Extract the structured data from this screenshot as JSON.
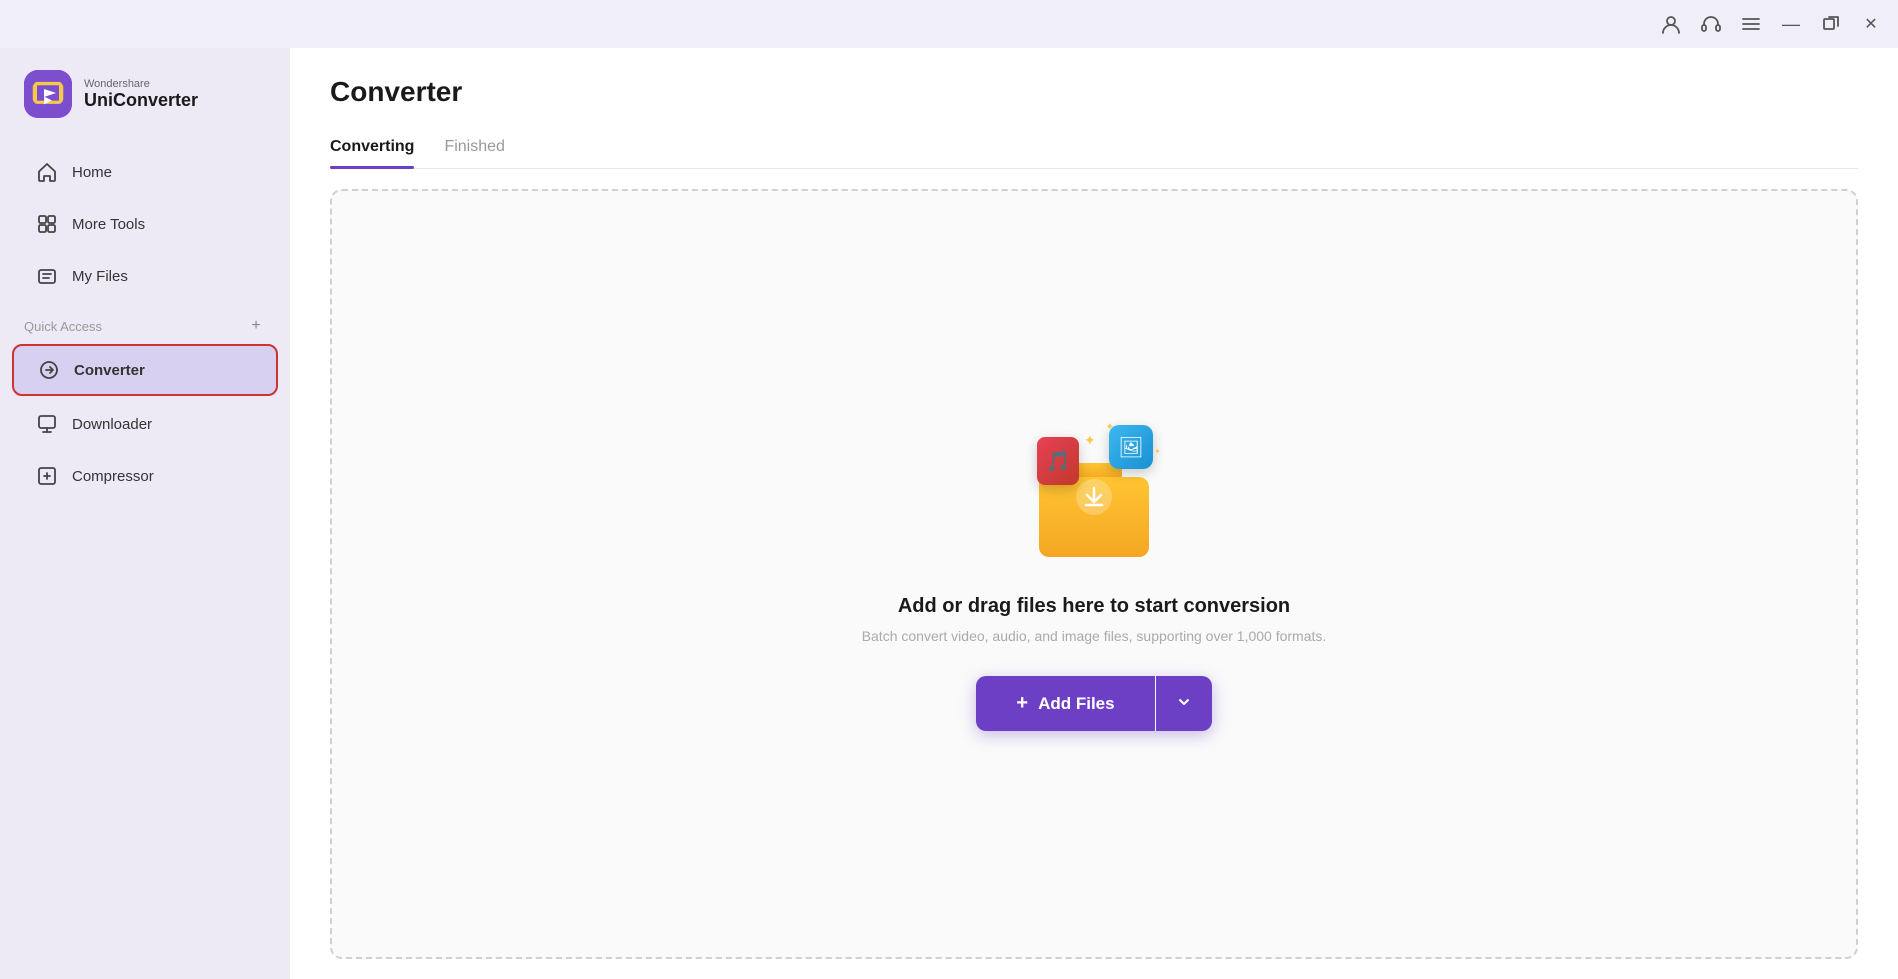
{
  "titlebar": {
    "buttons": [
      {
        "name": "user-icon",
        "symbol": "👤"
      },
      {
        "name": "headset-icon",
        "symbol": "🎧"
      },
      {
        "name": "menu-icon",
        "symbol": "☰"
      },
      {
        "name": "minimize-button",
        "symbol": "—"
      },
      {
        "name": "maximize-button",
        "symbol": "⧉"
      },
      {
        "name": "close-button",
        "symbol": "✕"
      }
    ]
  },
  "sidebar": {
    "logo": {
      "brand": "Wondershare",
      "product": "UniConverter"
    },
    "nav_items": [
      {
        "id": "home",
        "label": "Home",
        "icon": "⌂",
        "active": false
      },
      {
        "id": "more-tools",
        "label": "More Tools",
        "icon": "⊟",
        "active": false
      },
      {
        "id": "my-files",
        "label": "My Files",
        "icon": "▤",
        "active": false
      }
    ],
    "quick_access": {
      "label": "Quick Access",
      "add_symbol": "+"
    },
    "quick_access_items": [
      {
        "id": "converter",
        "label": "Converter",
        "icon": "⟳",
        "active": true
      },
      {
        "id": "downloader",
        "label": "Downloader",
        "icon": "⬇",
        "active": false
      },
      {
        "id": "compressor",
        "label": "Compressor",
        "icon": "⊡",
        "active": false
      }
    ]
  },
  "main": {
    "page_title": "Converter",
    "tabs": [
      {
        "id": "converting",
        "label": "Converting",
        "active": true
      },
      {
        "id": "finished",
        "label": "Finished",
        "active": false
      }
    ],
    "dropzone": {
      "title": "Add or drag files here to start conversion",
      "subtitle": "Batch convert video, audio, and image files, supporting over 1,000 formats.",
      "add_button_label": "+ Add Files",
      "add_button_main": "Add Files",
      "add_plus": "+"
    }
  },
  "colors": {
    "accent": "#6c3fc5",
    "active_nav_border": "#cc3333",
    "active_tab_underline": "#6c3fc5"
  }
}
